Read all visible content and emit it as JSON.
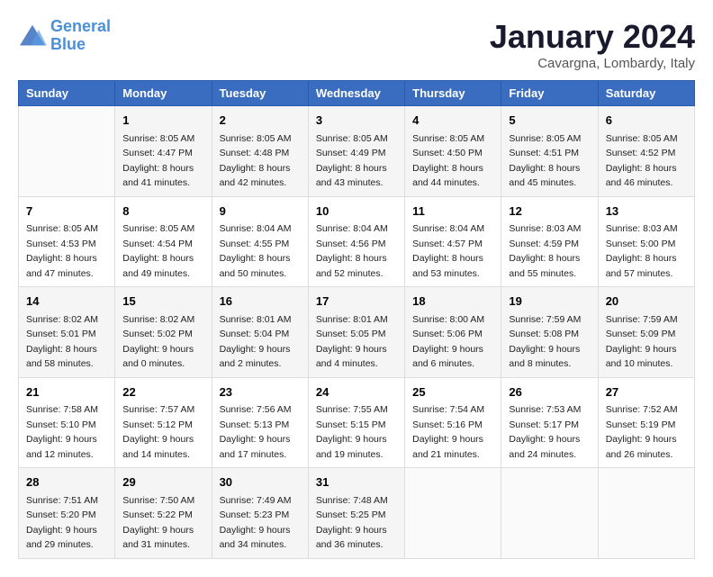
{
  "logo": {
    "line1": "General",
    "line2": "Blue"
  },
  "title": "January 2024",
  "location": "Cavargna, Lombardy, Italy",
  "days_header": [
    "Sunday",
    "Monday",
    "Tuesday",
    "Wednesday",
    "Thursday",
    "Friday",
    "Saturday"
  ],
  "weeks": [
    [
      {
        "num": "",
        "sunrise": "",
        "sunset": "",
        "daylight": ""
      },
      {
        "num": "1",
        "sunrise": "Sunrise: 8:05 AM",
        "sunset": "Sunset: 4:47 PM",
        "daylight": "Daylight: 8 hours and 41 minutes."
      },
      {
        "num": "2",
        "sunrise": "Sunrise: 8:05 AM",
        "sunset": "Sunset: 4:48 PM",
        "daylight": "Daylight: 8 hours and 42 minutes."
      },
      {
        "num": "3",
        "sunrise": "Sunrise: 8:05 AM",
        "sunset": "Sunset: 4:49 PM",
        "daylight": "Daylight: 8 hours and 43 minutes."
      },
      {
        "num": "4",
        "sunrise": "Sunrise: 8:05 AM",
        "sunset": "Sunset: 4:50 PM",
        "daylight": "Daylight: 8 hours and 44 minutes."
      },
      {
        "num": "5",
        "sunrise": "Sunrise: 8:05 AM",
        "sunset": "Sunset: 4:51 PM",
        "daylight": "Daylight: 8 hours and 45 minutes."
      },
      {
        "num": "6",
        "sunrise": "Sunrise: 8:05 AM",
        "sunset": "Sunset: 4:52 PM",
        "daylight": "Daylight: 8 hours and 46 minutes."
      }
    ],
    [
      {
        "num": "7",
        "sunrise": "Sunrise: 8:05 AM",
        "sunset": "Sunset: 4:53 PM",
        "daylight": "Daylight: 8 hours and 47 minutes."
      },
      {
        "num": "8",
        "sunrise": "Sunrise: 8:05 AM",
        "sunset": "Sunset: 4:54 PM",
        "daylight": "Daylight: 8 hours and 49 minutes."
      },
      {
        "num": "9",
        "sunrise": "Sunrise: 8:04 AM",
        "sunset": "Sunset: 4:55 PM",
        "daylight": "Daylight: 8 hours and 50 minutes."
      },
      {
        "num": "10",
        "sunrise": "Sunrise: 8:04 AM",
        "sunset": "Sunset: 4:56 PM",
        "daylight": "Daylight: 8 hours and 52 minutes."
      },
      {
        "num": "11",
        "sunrise": "Sunrise: 8:04 AM",
        "sunset": "Sunset: 4:57 PM",
        "daylight": "Daylight: 8 hours and 53 minutes."
      },
      {
        "num": "12",
        "sunrise": "Sunrise: 8:03 AM",
        "sunset": "Sunset: 4:59 PM",
        "daylight": "Daylight: 8 hours and 55 minutes."
      },
      {
        "num": "13",
        "sunrise": "Sunrise: 8:03 AM",
        "sunset": "Sunset: 5:00 PM",
        "daylight": "Daylight: 8 hours and 57 minutes."
      }
    ],
    [
      {
        "num": "14",
        "sunrise": "Sunrise: 8:02 AM",
        "sunset": "Sunset: 5:01 PM",
        "daylight": "Daylight: 8 hours and 58 minutes."
      },
      {
        "num": "15",
        "sunrise": "Sunrise: 8:02 AM",
        "sunset": "Sunset: 5:02 PM",
        "daylight": "Daylight: 9 hours and 0 minutes."
      },
      {
        "num": "16",
        "sunrise": "Sunrise: 8:01 AM",
        "sunset": "Sunset: 5:04 PM",
        "daylight": "Daylight: 9 hours and 2 minutes."
      },
      {
        "num": "17",
        "sunrise": "Sunrise: 8:01 AM",
        "sunset": "Sunset: 5:05 PM",
        "daylight": "Daylight: 9 hours and 4 minutes."
      },
      {
        "num": "18",
        "sunrise": "Sunrise: 8:00 AM",
        "sunset": "Sunset: 5:06 PM",
        "daylight": "Daylight: 9 hours and 6 minutes."
      },
      {
        "num": "19",
        "sunrise": "Sunrise: 7:59 AM",
        "sunset": "Sunset: 5:08 PM",
        "daylight": "Daylight: 9 hours and 8 minutes."
      },
      {
        "num": "20",
        "sunrise": "Sunrise: 7:59 AM",
        "sunset": "Sunset: 5:09 PM",
        "daylight": "Daylight: 9 hours and 10 minutes."
      }
    ],
    [
      {
        "num": "21",
        "sunrise": "Sunrise: 7:58 AM",
        "sunset": "Sunset: 5:10 PM",
        "daylight": "Daylight: 9 hours and 12 minutes."
      },
      {
        "num": "22",
        "sunrise": "Sunrise: 7:57 AM",
        "sunset": "Sunset: 5:12 PM",
        "daylight": "Daylight: 9 hours and 14 minutes."
      },
      {
        "num": "23",
        "sunrise": "Sunrise: 7:56 AM",
        "sunset": "Sunset: 5:13 PM",
        "daylight": "Daylight: 9 hours and 17 minutes."
      },
      {
        "num": "24",
        "sunrise": "Sunrise: 7:55 AM",
        "sunset": "Sunset: 5:15 PM",
        "daylight": "Daylight: 9 hours and 19 minutes."
      },
      {
        "num": "25",
        "sunrise": "Sunrise: 7:54 AM",
        "sunset": "Sunset: 5:16 PM",
        "daylight": "Daylight: 9 hours and 21 minutes."
      },
      {
        "num": "26",
        "sunrise": "Sunrise: 7:53 AM",
        "sunset": "Sunset: 5:17 PM",
        "daylight": "Daylight: 9 hours and 24 minutes."
      },
      {
        "num": "27",
        "sunrise": "Sunrise: 7:52 AM",
        "sunset": "Sunset: 5:19 PM",
        "daylight": "Daylight: 9 hours and 26 minutes."
      }
    ],
    [
      {
        "num": "28",
        "sunrise": "Sunrise: 7:51 AM",
        "sunset": "Sunset: 5:20 PM",
        "daylight": "Daylight: 9 hours and 29 minutes."
      },
      {
        "num": "29",
        "sunrise": "Sunrise: 7:50 AM",
        "sunset": "Sunset: 5:22 PM",
        "daylight": "Daylight: 9 hours and 31 minutes."
      },
      {
        "num": "30",
        "sunrise": "Sunrise: 7:49 AM",
        "sunset": "Sunset: 5:23 PM",
        "daylight": "Daylight: 9 hours and 34 minutes."
      },
      {
        "num": "31",
        "sunrise": "Sunrise: 7:48 AM",
        "sunset": "Sunset: 5:25 PM",
        "daylight": "Daylight: 9 hours and 36 minutes."
      },
      {
        "num": "",
        "sunrise": "",
        "sunset": "",
        "daylight": ""
      },
      {
        "num": "",
        "sunrise": "",
        "sunset": "",
        "daylight": ""
      },
      {
        "num": "",
        "sunrise": "",
        "sunset": "",
        "daylight": ""
      }
    ]
  ]
}
